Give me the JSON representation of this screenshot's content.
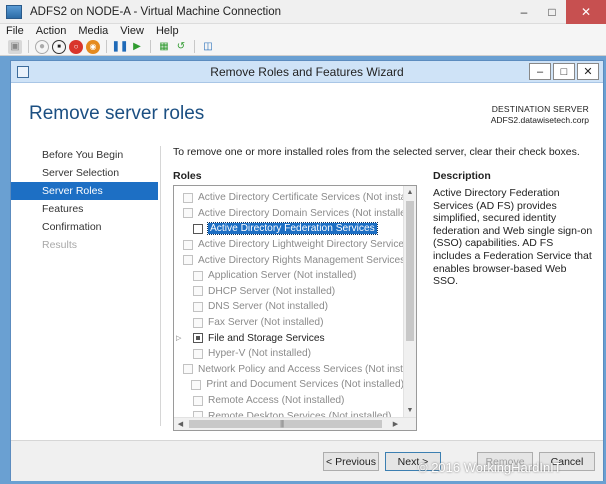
{
  "vm_window": {
    "title": "ADFS2 on NODE-A - Virtual Machine Connection",
    "menu": [
      "File",
      "Action",
      "Media",
      "View",
      "Help"
    ],
    "toolbar_icons": [
      "ctrl-alt-del-icon",
      "start-icon",
      "turn-off-icon",
      "shutdown-icon",
      "save-state-icon",
      "pause-icon",
      "resume-icon",
      "snapshot-icon",
      "revert-icon",
      "enhanced-session-icon"
    ]
  },
  "wizard": {
    "title": "Remove Roles and Features Wizard",
    "page_title": "Remove server roles",
    "destination_label": "DESTINATION SERVER",
    "destination_server": "ADFS2.datawisetech.corp",
    "nav": [
      {
        "label": "Before You Begin",
        "state": "normal"
      },
      {
        "label": "Server Selection",
        "state": "normal"
      },
      {
        "label": "Server Roles",
        "state": "active"
      },
      {
        "label": "Features",
        "state": "normal"
      },
      {
        "label": "Confirmation",
        "state": "normal"
      },
      {
        "label": "Results",
        "state": "disabled"
      }
    ],
    "instruction": "To remove one or more installed roles from the selected server, clear their check boxes.",
    "roles_label": "Roles",
    "description_label": "Description",
    "description_text": "Active Directory Federation Services (AD FS) provides simplified, secured identity federation and Web single sign-on (SSO) capabilities. AD FS includes a Federation Service that enables browser-based Web SSO.",
    "roles": [
      {
        "label": "Active Directory Certificate Services (Not installed)",
        "enabled": false,
        "selected": false,
        "expandable": false
      },
      {
        "label": "Active Directory Domain Services (Not installed)",
        "enabled": false,
        "selected": false,
        "expandable": false
      },
      {
        "label": "Active Directory Federation Services",
        "enabled": true,
        "selected": true,
        "expandable": false
      },
      {
        "label": "Active Directory Lightweight Directory Services (N",
        "enabled": false,
        "selected": false,
        "expandable": false
      },
      {
        "label": "Active Directory Rights Management Services (No",
        "enabled": false,
        "selected": false,
        "expandable": false
      },
      {
        "label": "Application Server (Not installed)",
        "enabled": false,
        "selected": false,
        "expandable": false
      },
      {
        "label": "DHCP Server (Not installed)",
        "enabled": false,
        "selected": false,
        "expandable": false
      },
      {
        "label": "DNS Server (Not installed)",
        "enabled": false,
        "selected": false,
        "expandable": false
      },
      {
        "label": "Fax Server (Not installed)",
        "enabled": false,
        "selected": false,
        "expandable": false
      },
      {
        "label": "File and Storage Services",
        "enabled": true,
        "selected": false,
        "expandable": true
      },
      {
        "label": "Hyper-V (Not installed)",
        "enabled": false,
        "selected": false,
        "expandable": false
      },
      {
        "label": "Network Policy and Access Services (Not installed)",
        "enabled": false,
        "selected": false,
        "expandable": false
      },
      {
        "label": "Print and Document Services (Not installed)",
        "enabled": false,
        "selected": false,
        "expandable": false
      },
      {
        "label": "Remote Access (Not installed)",
        "enabled": false,
        "selected": false,
        "expandable": false
      },
      {
        "label": "Remote Desktop Services (Not installed)",
        "enabled": false,
        "selected": false,
        "expandable": false
      }
    ],
    "buttons": {
      "previous": "< Previous",
      "next": "Next >",
      "remove": "Remove",
      "cancel": "Cancel"
    }
  },
  "watermark": "© 2016 WorkingHardInIT"
}
